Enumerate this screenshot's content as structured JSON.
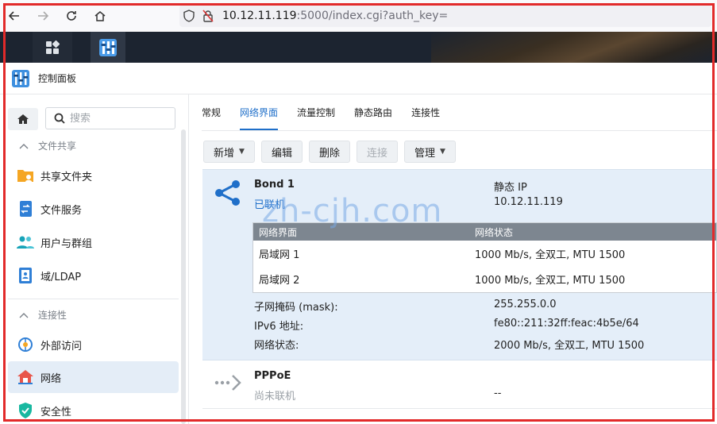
{
  "browser": {
    "url_host": "10.12.11.119",
    "url_rest": ":5000/index.cgi?auth_key="
  },
  "window": {
    "title": "控制面板"
  },
  "sidebar": {
    "search_placeholder": "搜索",
    "sections": [
      {
        "label": "文件共享",
        "items": [
          {
            "label": "共享文件夹",
            "icon": "shared-folder-icon"
          },
          {
            "label": "文件服务",
            "icon": "file-services-icon"
          },
          {
            "label": "用户与群组",
            "icon": "users-groups-icon"
          },
          {
            "label": "域/LDAP",
            "icon": "domain-ldap-icon"
          }
        ]
      },
      {
        "label": "连接性",
        "items": [
          {
            "label": "外部访问",
            "icon": "external-access-icon"
          },
          {
            "label": "网络",
            "icon": "network-icon",
            "active": true
          },
          {
            "label": "安全性",
            "icon": "security-icon"
          }
        ]
      }
    ]
  },
  "tabs": [
    "常规",
    "网络界面",
    "流量控制",
    "静态路由",
    "连接性"
  ],
  "active_tab": "网络界面",
  "toolbar": {
    "create": "新增",
    "edit": "编辑",
    "delete": "删除",
    "connect": "连接",
    "manage": "管理"
  },
  "bond": {
    "name": "Bond 1",
    "status": "已联机",
    "type": "静态 IP",
    "ip": "10.12.11.119",
    "iface_headers": [
      "网络界面",
      "网络状态"
    ],
    "ifaces": [
      {
        "name": "局域网 1",
        "status": "1000 Mb/s, 全双工, MTU 1500"
      },
      {
        "name": "局域网 2",
        "status": "1000 Mb/s, 全双工, MTU 1500"
      }
    ],
    "details": [
      {
        "key": "子网掩码 (mask):",
        "value": "255.255.0.0"
      },
      {
        "key": "IPv6 地址:",
        "value": "fe80::211:32ff:feac:4b5e/64"
      },
      {
        "key": "网络状态:",
        "value": "2000 Mb/s, 全双工, MTU 1500"
      }
    ]
  },
  "pppoe": {
    "name": "PPPoE",
    "status": "尚未联机",
    "value": "--"
  },
  "watermark": "zh-cjh.com",
  "colors": {
    "accent": "#1f6fc9",
    "highlight_row": "#e4eef9",
    "frame": "#e22a2a"
  }
}
